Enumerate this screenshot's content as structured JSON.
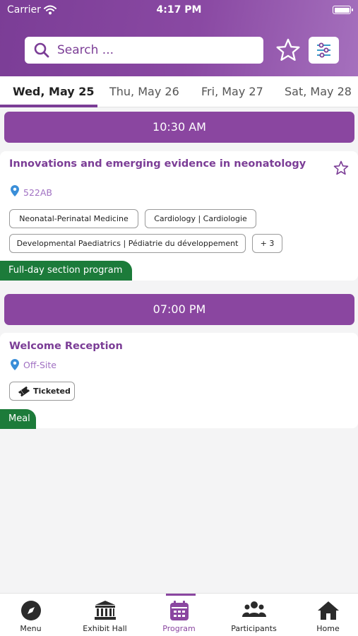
{
  "status_bar": {
    "carrier": "Carrier",
    "time": "4:17 PM"
  },
  "search": {
    "placeholder": "Search ..."
  },
  "header_icons": {
    "favorites": "star-outline-icon",
    "filter": "sliders-icon"
  },
  "colors": {
    "brand_purple": "#8a46a0",
    "tag_green": "#1c7b3a",
    "location_blue": "#3a8ed8"
  },
  "date_tabs": [
    {
      "label": "Wed, May 25",
      "active": true
    },
    {
      "label": "Thu, May 26",
      "active": false
    },
    {
      "label": "Fri, May 27",
      "active": false
    },
    {
      "label": "Sat, May 28",
      "active": false
    }
  ],
  "sessions": [
    {
      "time": "10:30 AM",
      "title": "Innovations and emerging evidence in neonatology",
      "location": "522AB",
      "tags": [
        "Neonatal-Perinatal Medicine",
        "Cardiology | Cardiologie",
        "Developmental Paediatrics | Pédiatrie du développement",
        "+ 3"
      ],
      "badge": "Full-day section program"
    },
    {
      "time": "07:00 PM",
      "title": "Welcome Reception",
      "location": "Off-Site",
      "tags": [
        "Ticketed"
      ],
      "badge": "Meal"
    }
  ],
  "bottom_nav": [
    {
      "label": "Menu",
      "icon": "compass-icon"
    },
    {
      "label": "Exhibit Hall",
      "icon": "building-icon"
    },
    {
      "label": "Program",
      "icon": "calendar-icon",
      "active": true
    },
    {
      "label": "Participants",
      "icon": "group-icon"
    },
    {
      "label": "Home",
      "icon": "home-icon"
    }
  ]
}
